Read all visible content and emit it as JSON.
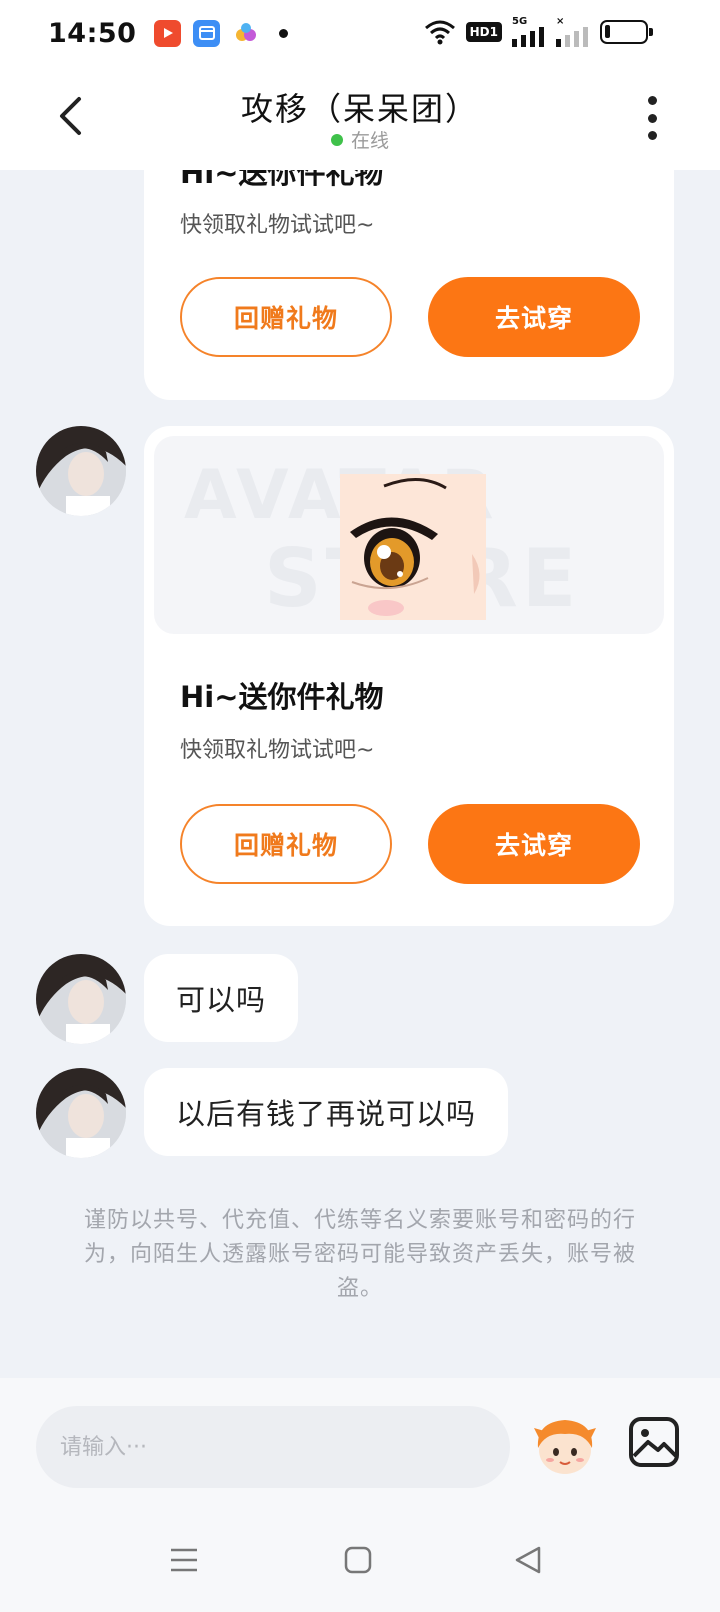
{
  "status_bar": {
    "time": "14:50",
    "network_badge": "HD1",
    "signal_label": "5G",
    "signal_label_2": "×",
    "battery_level": 0.12
  },
  "header": {
    "title": "攻移（呆呆团）",
    "status": "在线",
    "status_color": "#3fc14a"
  },
  "gift_cards": [
    {
      "title": "Hi~送你件礼物",
      "subtitle": "快领取礼物试试吧~",
      "return_gift_label": "回赠礼物",
      "try_on_label": "去试穿"
    },
    {
      "title": "Hi~送你件礼物",
      "subtitle": "快领取礼物试试吧~",
      "watermark_1": "AVATAR",
      "watermark_2": "STORE",
      "return_gift_label": "回赠礼物",
      "try_on_label": "去试穿"
    }
  ],
  "messages": [
    {
      "text": "可以吗"
    },
    {
      "text": "以后有钱了再说可以吗"
    }
  ],
  "notice": "谨防以共号、代充值、代练等名义索要账号和密码的行为，向陌生人透露账号密码可能导致资产丢失，账号被盗。",
  "input": {
    "placeholder": "请输入···"
  },
  "colors": {
    "accent": "#fc7614",
    "background": "#eff2f7"
  },
  "icons": [
    "back-icon",
    "more-icon",
    "emoji-icon",
    "image-icon",
    "menu-icon",
    "home-icon",
    "back-nav-icon"
  ]
}
